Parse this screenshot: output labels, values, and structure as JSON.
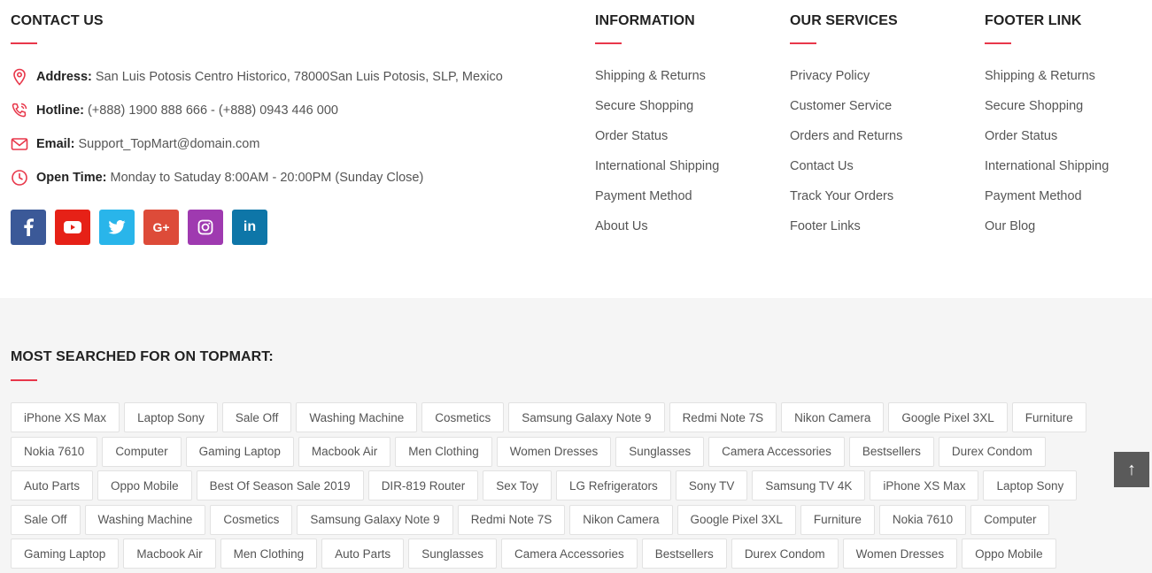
{
  "contact": {
    "heading": "CONTACT US",
    "rows": [
      {
        "icon": "location-pin-icon",
        "label": "Address:",
        "value": "San Luis Potosis Centro Historico, 78000San Luis Potosis, SLP, Mexico"
      },
      {
        "icon": "phone-icon",
        "label": "Hotline:",
        "value": "(+888) 1900 888 666 - (+888) 0943 446 000"
      },
      {
        "icon": "envelope-icon",
        "label": "Email:",
        "value": "Support_TopMart@domain.com"
      },
      {
        "icon": "clock-icon",
        "label": "Open Time:",
        "value": "Monday to Satuday 8:00AM - 20:00PM (Sunday Close)"
      }
    ],
    "socials": [
      {
        "icon": "facebook-icon",
        "glyph": "f",
        "color": "#3b5998"
      },
      {
        "icon": "youtube-icon",
        "glyph": "▶",
        "color": "#e62117"
      },
      {
        "icon": "twitter-icon",
        "glyph": "t",
        "color": "#29b5ea"
      },
      {
        "icon": "google-plus-icon",
        "glyph": "G+",
        "color": "#dd4b39"
      },
      {
        "icon": "instagram-icon",
        "glyph": "◎",
        "color": "#9f3ab0"
      },
      {
        "icon": "linkedin-icon",
        "glyph": "in",
        "color": "#0e76a8"
      }
    ]
  },
  "information": {
    "heading": "INFORMATION",
    "links": [
      "Shipping & Returns",
      "Secure Shopping",
      "Order Status",
      "International Shipping",
      "Payment Method",
      "About Us"
    ]
  },
  "services": {
    "heading": "OUR SERVICES",
    "links": [
      "Privacy Policy",
      "Customer Service",
      "Orders and Returns",
      "Contact Us",
      "Track Your Orders",
      "Footer Links"
    ]
  },
  "footer_link": {
    "heading": "FOOTER LINK",
    "links": [
      "Shipping & Returns",
      "Secure Shopping",
      "Order Status",
      "International Shipping",
      "Payment Method",
      "Our Blog"
    ]
  },
  "most_searched": {
    "heading": "MOST SEARCHED FOR ON TOPMART:",
    "tags": [
      "iPhone XS Max",
      "Laptop Sony",
      "Sale Off",
      "Washing Machine",
      "Cosmetics",
      "Samsung Galaxy Note 9",
      "Redmi Note 7S",
      "Nikon Camera",
      "Google Pixel 3XL",
      "Furniture",
      "Nokia 7610",
      "Computer",
      "Gaming Laptop",
      "Macbook Air",
      "Men Clothing",
      "Women Dresses",
      "Sunglasses",
      "Camera Accessories",
      "Bestsellers",
      "Durex Condom",
      "Auto Parts",
      "Oppo Mobile",
      "Best Of Season Sale 2019",
      "DIR-819 Router",
      "Sex Toy",
      "LG Refrigerators",
      "Sony TV",
      "Samsung TV 4K",
      "iPhone XS Max",
      "Laptop Sony",
      "Sale Off",
      "Washing Machine",
      "Cosmetics",
      "Samsung Galaxy Note 9",
      "Redmi Note 7S",
      "Nikon Camera",
      "Google Pixel 3XL",
      "Furniture",
      "Nokia 7610",
      "Computer",
      "Gaming Laptop",
      "Macbook Air",
      "Men Clothing",
      "Auto Parts",
      "Sunglasses",
      "Camera Accessories",
      "Bestsellers",
      "Durex Condom",
      "Women Dresses",
      "Oppo Mobile"
    ]
  },
  "back_to_top": {
    "icon": "arrow-up-icon",
    "glyph": "↑"
  },
  "colors": {
    "accent": "#e8374a",
    "bottom_bg": "#f5f5f5"
  }
}
